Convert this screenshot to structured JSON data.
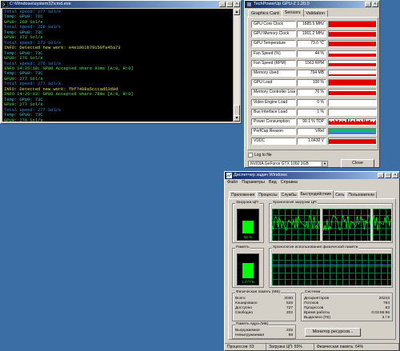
{
  "cmd": {
    "title": "C:\\Windows\\system32\\cmd.exe",
    "lines": [
      {
        "text": "Total speed: 277 Sol/s",
        "color": "blue"
      },
      {
        "text": "Temp: GPU0: 72C",
        "color": "cyan"
      },
      {
        "text": "GPU0: 269 Sol/s",
        "color": "green"
      },
      {
        "text": "Total speed: 269 Sol/s",
        "color": "blue"
      },
      {
        "text": "Temp: GPU0: 73C",
        "color": "cyan"
      },
      {
        "text": "GPU0: 272 Sol/s",
        "color": "green"
      },
      {
        "text": "Total speed: 273 Sol/s",
        "color": "blue"
      },
      {
        "text": "INFO: Detected new work: e4e1961b79159fa45a73",
        "color": "yellow"
      },
      {
        "text": "Temp: GPU0: 73C",
        "color": "cyan"
      },
      {
        "text": "GPU0: 276 Sol/s",
        "color": "green"
      },
      {
        "text": "Total speed: 276 Sol/s",
        "color": "blue"
      },
      {
        "text": "INFO 14:25:18: GPU0 Accepted share 93ms [A:8, R:0]",
        "color": "green"
      },
      {
        "text": "Temp: GPU0: 73C",
        "color": "cyan"
      },
      {
        "text": "GPU0: 277 Sol/s",
        "color": "green"
      },
      {
        "text": "Total speed: 277 Sol/s",
        "color": "blue"
      },
      {
        "text": "INFO: Detected new work: fbf7488a5cccad53d9d",
        "color": "yellow"
      },
      {
        "text": "INFO 14:26:03: GPU0 Accepted share 78ms [A:9, R:0]",
        "color": "green"
      },
      {
        "text": "Temp: GPU0: 73C",
        "color": "cyan"
      },
      {
        "text": "GPU0: 277 Sol/s",
        "color": "green"
      },
      {
        "text": "Total speed: 277 Sol/s",
        "color": "blue"
      },
      {
        "text": "Temp: GPU0: 73C",
        "color": "cyan"
      },
      {
        "text": "GPU0: 276 Sol/s",
        "color": "green"
      },
      {
        "text": "Total speed: 276 Sol/s",
        "color": "blue"
      },
      {
        "text": "Temp: GPU0: 73C",
        "color": "cyan"
      },
      {
        "text": "GPU0: 276 Sol/s",
        "color": "green"
      },
      {
        "text": "Total speed: 276 Sol/s",
        "color": "blue"
      },
      {
        "text": "INFO 14:26:50: GPU0 Accepted share 78ms [A:10, R:0]",
        "color": "green"
      }
    ]
  },
  "gpuz": {
    "title": "TechPowerUp GPU-Z 1.20.0",
    "tabs": [
      "Graphics Card",
      "Sensors",
      "Validation"
    ],
    "active_tab": 1,
    "sensors": [
      {
        "label": "GPU Core Clock",
        "value": "1885.5 MHz",
        "level": 0.95,
        "kind": "fill"
      },
      {
        "label": "GPU Memory Clock",
        "value": "1901.2 MHz",
        "level": 0.95,
        "kind": "fill"
      },
      {
        "label": "GPU Temperature",
        "value": "73.0 °C",
        "level": 0.9,
        "kind": "fill"
      },
      {
        "label": "Fan Speed (%)",
        "value": "44 %",
        "level": 0.5,
        "kind": "fill"
      },
      {
        "label": "Fan Speed (RPM)",
        "value": "1563 RPM",
        "level": 0.55,
        "kind": "fill"
      },
      {
        "label": "Memory Used",
        "value": "794 MB",
        "level": 0.25,
        "kind": "fill"
      },
      {
        "label": "GPU Load",
        "value": "100 %",
        "level": 1.0,
        "kind": "fill"
      },
      {
        "label": "Memory Controller Load",
        "value": "76 %",
        "level": 0.76,
        "kind": "fill"
      },
      {
        "label": "Video Engine Load",
        "value": "0 %",
        "level": 0,
        "kind": "fill"
      },
      {
        "label": "Bus Interface Load",
        "value": "1 %",
        "level": 0.02,
        "kind": "fill"
      },
      {
        "label": "Power Consumption",
        "value": "99.1 % TDP",
        "level": 0.99,
        "kind": "noisy"
      },
      {
        "label": "PerfCap Reason",
        "value": "VRel",
        "level": 1.0,
        "kind": "perfcap"
      },
      {
        "label": "VDDC",
        "value": "1.0430 V",
        "level": 0.95,
        "kind": "fill"
      }
    ],
    "log_label": "Log to file",
    "gpu_name": "NVIDIA GeForce GTX 1060 3GB",
    "close_label": "Close",
    "colors": {
      "graph": "#e00000",
      "perfcap_a": "#00c060",
      "perfcap_b": "#3a7fe0"
    }
  },
  "tm": {
    "title": "Диспетчер задач Windows",
    "menu": [
      "Файл",
      "Параметры",
      "Вид",
      "Справка"
    ],
    "tabs": [
      "Приложения",
      "Процессы",
      "Службы",
      "Быстродействие",
      "Сеть",
      "Пользователи"
    ],
    "active_tab": 3,
    "cpu_box": "Загрузка ЦП",
    "cpu_pct": "55 %",
    "cpu_level": 0.55,
    "cpu_hist": "Хронология загрузки ЦП",
    "mem_box": "Память",
    "mem_val": "1,27 ГБ",
    "mem_level": 0.64,
    "mem_hist": "Хронология использования физической памяти",
    "phys_title": "Физическая память (МБ)",
    "phys": [
      {
        "k": "Всего",
        "v": "2030"
      },
      {
        "k": "Кэшировано",
        "v": "526"
      },
      {
        "k": "Доступно",
        "v": "727"
      },
      {
        "k": "Свободно",
        "v": "202"
      }
    ],
    "sys_title": "Система",
    "sys": [
      {
        "k": "Дескрипторов",
        "v": "20243"
      },
      {
        "k": "Потоков",
        "v": "794"
      },
      {
        "k": "Процессов",
        "v": "63"
      },
      {
        "k": "Время работы",
        "v": "0:03:55:56"
      },
      {
        "k": "Выделено (ГБ)",
        "v": "3 / 9"
      }
    ],
    "kernel_title": "Память ядра (МБ)",
    "kernel": [
      {
        "k": "Выгружаемая",
        "v": "226"
      },
      {
        "k": "Невыгружаемая",
        "v": "58"
      }
    ],
    "resmon_label": "Монитор ресурсов...",
    "status": {
      "processes": "Процессов: 63",
      "cpu": "Загрузка ЦП: 55%",
      "memory": "Физическая память: 64%"
    }
  }
}
